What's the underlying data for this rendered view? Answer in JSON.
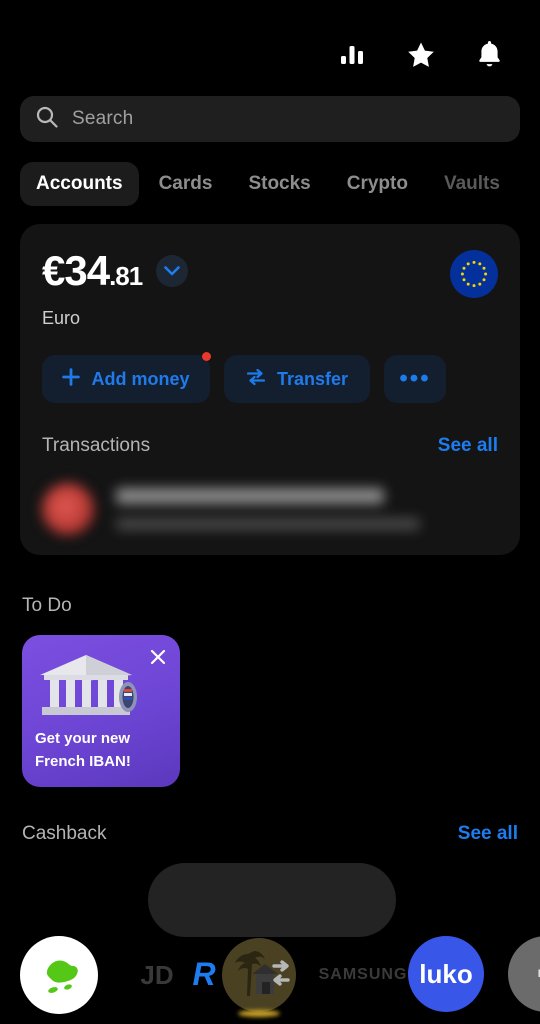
{
  "header": {
    "icons": [
      {
        "name": "analytics-icon",
        "label": "Analytics"
      },
      {
        "name": "star-icon",
        "label": "Favourites"
      },
      {
        "name": "bell-icon",
        "label": "Notifications"
      }
    ]
  },
  "search": {
    "placeholder": "Search",
    "value": "",
    "icon": "search-icon"
  },
  "tabs": [
    {
      "label": "Accounts",
      "active": true,
      "dim": false
    },
    {
      "label": "Cards",
      "active": false,
      "dim": false
    },
    {
      "label": "Stocks",
      "active": false,
      "dim": false
    },
    {
      "label": "Crypto",
      "active": false,
      "dim": false
    },
    {
      "label": "Vaults",
      "active": false,
      "dim": true
    }
  ],
  "account": {
    "currency_symbol": "€",
    "balance_whole": "34",
    "balance_cents": ".81",
    "balance_full": "€34.81",
    "currency_name": "Euro",
    "flag": "eu-flag-icon",
    "chevron": "chevron-down-icon",
    "actions": [
      {
        "label": "Add money",
        "icon": "plus-icon",
        "badge": true
      },
      {
        "label": "Transfer",
        "icon": "transfer-icon",
        "badge": false
      },
      {
        "label": "•••",
        "icon": "more-icon",
        "badge": false
      }
    ]
  },
  "transactions": {
    "title": "Transactions",
    "see_all": "See all",
    "redacted": true,
    "rows": [
      {
        "title": "",
        "subtitle": "",
        "avatar_color": "#c2403a",
        "blurred": true
      }
    ]
  },
  "todo": {
    "title": "To Do",
    "card": {
      "line1": "Get your new",
      "line2": "French IBAN!",
      "close": "close-icon",
      "art": "bank-building-icon",
      "bg_from": "#7c4fe0",
      "bg_to": "#5b38bd"
    }
  },
  "cashback": {
    "title": "Cashback",
    "see_all": "See all",
    "merchants": [
      {
        "name": "green-blob-logo",
        "label": ""
      },
      {
        "name": "jd-logo",
        "label": "JD"
      },
      {
        "name": "revolut-r-logo",
        "label": "R"
      },
      {
        "name": "samsung-logo",
        "label": "SAMSUNG"
      },
      {
        "name": "luko-logo",
        "label": "luko"
      },
      {
        "name": "my-logo",
        "label": "MY"
      }
    ]
  },
  "overlay": {
    "name": "holiday-transfer-overlay-icon"
  },
  "colors": {
    "background": "#000000",
    "card": "#141414",
    "search": "#1f1f1f",
    "accent_blue": "#1d7df0",
    "action_bg": "#131f2e",
    "badge_red": "#e8392c",
    "todo_purple": "#6d45d4",
    "eu_blue": "#03309b",
    "eu_star": "#f5d400"
  }
}
